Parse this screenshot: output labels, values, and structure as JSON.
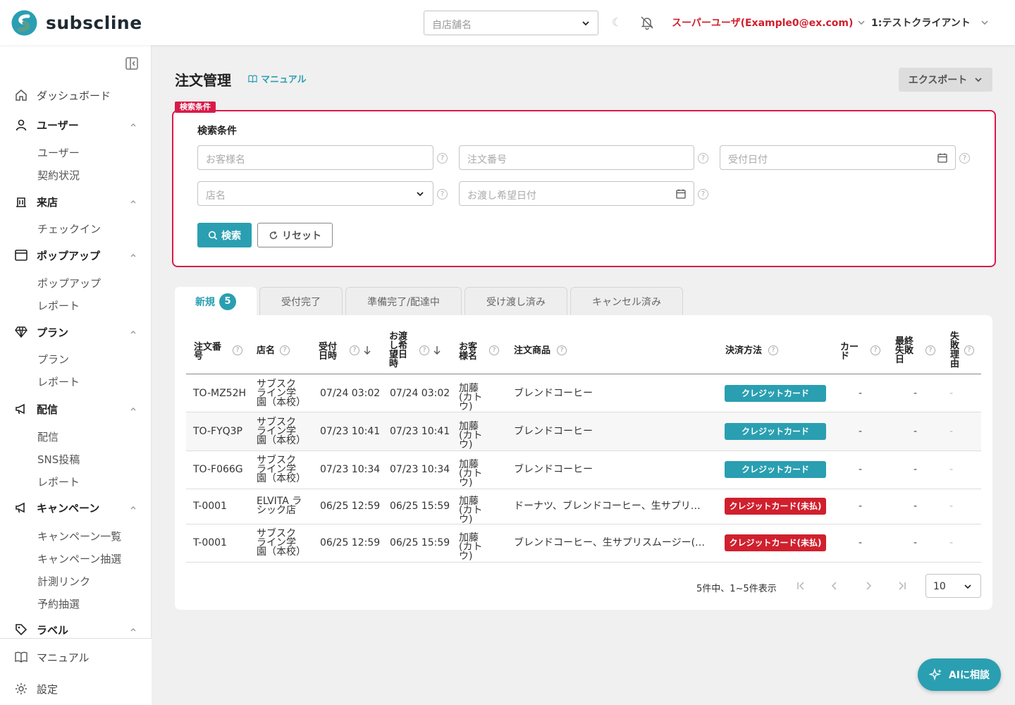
{
  "colors": {
    "accent": "#2a9fb1",
    "danger": "#d0202e",
    "highlight_border": "#d81b49"
  },
  "header": {
    "logo_text": "subscline",
    "store_placeholder": "自店舗名",
    "user_label": "スーパーユーザ(Example0@ex.com)",
    "client_label": "1:テストクライアント"
  },
  "sidebar": {
    "dashboard": "ダッシュボード",
    "user_group": "ユーザー",
    "user_items": [
      "ユーザー",
      "契約状況"
    ],
    "visit_group": "来店",
    "visit_items": [
      "チェックイン"
    ],
    "popup_group": "ポップアップ",
    "popup_items": [
      "ポップアップ",
      "レポート"
    ],
    "plan_group": "プラン",
    "plan_items": [
      "プラン",
      "レポート"
    ],
    "delivery_group": "配信",
    "delivery_items": [
      "配信",
      "SNS投稿",
      "レポート"
    ],
    "campaign_group": "キャンペーン",
    "campaign_items": [
      "キャンペーン一覧",
      "キャンペーン抽選",
      "計測リンク",
      "予約抽選"
    ],
    "label_group": "ラベル",
    "manual": "マニュアル",
    "settings": "設定"
  },
  "page": {
    "title": "注文管理",
    "manual_link": "マニュアル",
    "export_label": "エクスポート"
  },
  "search": {
    "tag": "検索条件",
    "heading": "検索条件",
    "customer_placeholder": "お客様名",
    "order_no_placeholder": "注文番号",
    "received_date_placeholder": "受付日付",
    "store_placeholder": "店名",
    "handover_date_placeholder": "お渡し希望日付",
    "search_label": "検索",
    "reset_label": "リセット"
  },
  "tabs": [
    {
      "label": "新規",
      "count": "5"
    },
    {
      "label": "受付完了"
    },
    {
      "label": "準備完了/配達中"
    },
    {
      "label": "受け渡し済み"
    },
    {
      "label": "キャンセル済み"
    }
  ],
  "table": {
    "headers": [
      "注文番号",
      "店名",
      "受付日時",
      "お渡し希望日時",
      "お客様名",
      "注文商品",
      "決済方法",
      "カード",
      "最終失敗日",
      "失敗理由"
    ],
    "rows": [
      {
        "order_no": "TO-MZ52H",
        "store": "サブスクライン学園（本校）",
        "received": "07/24 03:02",
        "handover": "07/24 03:02",
        "customer": "加藤(カトウ)",
        "items": "ブレンドコーヒー",
        "payment": "クレジットカード",
        "payment_status": "paid",
        "card": "-",
        "last_failed": "-",
        "reason": "-"
      },
      {
        "order_no": "TO-FYQ3P",
        "store": "サブスクライン学園（本校）",
        "received": "07/23 10:41",
        "handover": "07/23 10:41",
        "customer": "加藤(カトウ)",
        "items": "ブレンドコーヒー",
        "payment": "クレジットカード",
        "payment_status": "paid",
        "card": "-",
        "last_failed": "-",
        "reason": "-"
      },
      {
        "order_no": "TO-F066G",
        "store": "サブスクライン学園（本校）",
        "received": "07/23 10:34",
        "handover": "07/23 10:34",
        "customer": "加藤(カトウ)",
        "items": "ブレンドコーヒー",
        "payment": "クレジットカード",
        "payment_status": "paid",
        "card": "-",
        "last_failed": "-",
        "reason": "-"
      },
      {
        "order_no": "T-0001",
        "store": "ELVITA ラシック店",
        "received": "06/25 12:59",
        "handover": "06/25 15:59",
        "customer": "加藤(カトウ)",
        "items": "ドーナツ、ブレンドコーヒー、生サプリ…",
        "payment": "クレジットカード(未払)",
        "payment_status": "unpaid",
        "card": "-",
        "last_failed": "-",
        "reason": "-"
      },
      {
        "order_no": "T-0001",
        "store": "サブスクライン学園（本校）",
        "received": "06/25 12:59",
        "handover": "06/25 15:59",
        "customer": "加藤(カトウ)",
        "items": "ブレンドコーヒー、生サプリスムージー(…",
        "payment": "クレジットカード(未払)",
        "payment_status": "unpaid",
        "card": "-",
        "last_failed": "-",
        "reason": "-"
      }
    ]
  },
  "pagination": {
    "summary": "5件中、1~5件表示",
    "per_page": "10"
  },
  "ai_button": "AIに相談"
}
